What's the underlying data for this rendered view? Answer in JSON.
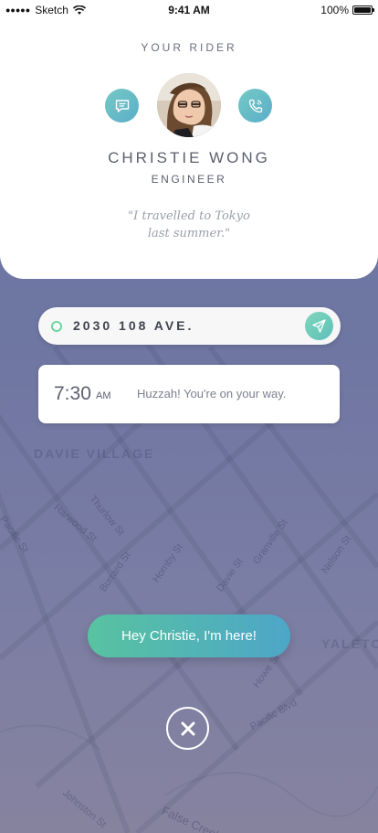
{
  "status_bar": {
    "carrier": "Sketch",
    "time": "9:41 AM",
    "battery": "100%",
    "battery_level": 1.0,
    "icons": {
      "signal": "signal-dots-icon",
      "wifi": "wifi-icon",
      "battery": "battery-icon"
    }
  },
  "rider_card": {
    "heading": "YOUR RIDER",
    "name": "CHRISTIE WONG",
    "role": "ENGINEER",
    "quote_line1": "\"I travelled to Tokyo",
    "quote_line2": "last summer.\"",
    "message_icon": "chat-icon",
    "call_icon": "phone-icon"
  },
  "address": {
    "value": "2030 108 AVE.",
    "nav_icon": "navigation-arrow-icon"
  },
  "eta": {
    "time": "7:30",
    "ampm": "AM",
    "message": "Huzzah! You're on your way."
  },
  "actions": {
    "here_label": "Hey Christie, I'm here!",
    "close_icon": "close-icon"
  },
  "map": {
    "labels": {
      "davie_village": "DAVIE VILLAGE",
      "yaletown": "YALETO",
      "pacific_st": "Pacific St",
      "harwood_st": "Harwood St",
      "thurlow_st": "Thurlow St",
      "burrard_st": "Burrard St",
      "hornby_st": "Hornby St",
      "granville_st": "Granville St",
      "nelson_st": "Nelson St",
      "davie_st": "Davie St",
      "howe_st": "Howe St",
      "pacific_blvd": "Pacific Blvd",
      "johnston_st": "Johnston St",
      "false_creek": "False Creek"
    }
  },
  "colors": {
    "accent_teal": "#5aaec9",
    "accent_green": "#58c3a0",
    "map_tint": "#6e76a2",
    "text_dark": "#5a5f6d",
    "quote_gray": "#9aa0ab"
  }
}
